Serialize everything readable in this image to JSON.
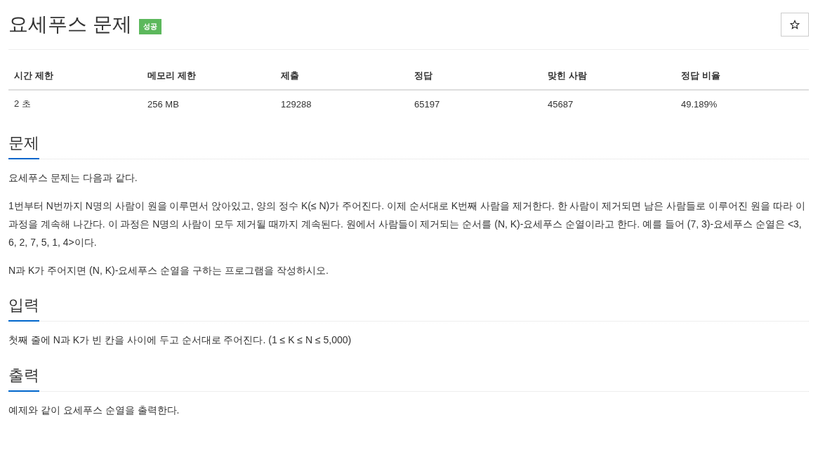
{
  "title": "요세푸스 문제",
  "badge": "성공",
  "table": {
    "columns": [
      "시간 제한",
      "메모리 제한",
      "제출",
      "정답",
      "맞힌 사람",
      "정답 비율"
    ],
    "rows": [
      [
        "2 초",
        "256 MB",
        "129288",
        "65197",
        "45687",
        "49.189%"
      ]
    ]
  },
  "sections": [
    {
      "heading": "문제",
      "paragraphs": [
        "요세푸스 문제는 다음과 같다.",
        "1번부터 N번까지 N명의 사람이 원을 이루면서 앉아있고, 양의 정수 K(≤ N)가 주어진다. 이제 순서대로 K번째 사람을 제거한다. 한 사람이 제거되면 남은 사람들로 이루어진 원을 따라 이 과정을 계속해 나간다. 이 과정은 N명의 사람이 모두 제거될 때까지 계속된다. 원에서 사람들이 제거되는 순서를 (N, K)-요세푸스 순열이라고 한다. 예를 들어 (7, 3)-요세푸스 순열은 <3, 6, 2, 7, 5, 1, 4>이다.",
        "N과 K가 주어지면 (N, K)-요세푸스 순열을 구하는 프로그램을 작성하시오."
      ]
    },
    {
      "heading": "입력",
      "paragraphs": [
        "첫째 줄에 N과 K가 빈 칸을 사이에 두고 순서대로 주어진다. (1 ≤ K ≤ N ≤ 5,000)"
      ]
    },
    {
      "heading": "출력",
      "paragraphs": [
        "예제와 같이 요세푸스 순열을 출력한다."
      ]
    }
  ]
}
